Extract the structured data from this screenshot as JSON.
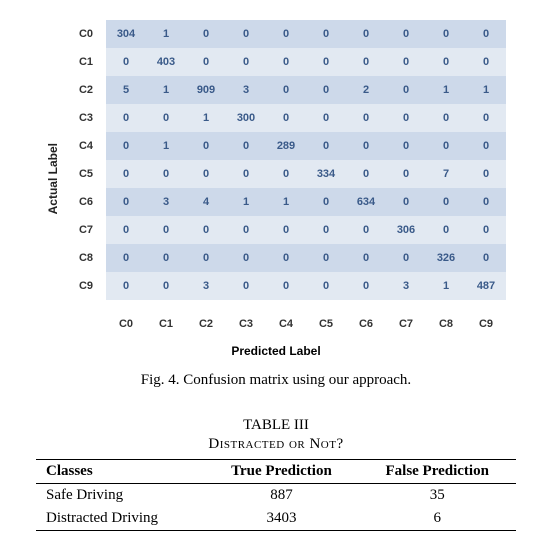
{
  "chart_data": {
    "type": "heatmap",
    "title": "",
    "xlabel": "Predicted Label",
    "ylabel": "Actual Label",
    "row_labels": [
      "C0",
      "C1",
      "C2",
      "C3",
      "C4",
      "C5",
      "C6",
      "C7",
      "C8",
      "C9"
    ],
    "col_labels": [
      "C0",
      "C1",
      "C2",
      "C3",
      "C4",
      "C5",
      "C6",
      "C7",
      "C8",
      "C9"
    ],
    "values": [
      [
        304,
        1,
        0,
        0,
        0,
        0,
        0,
        0,
        0,
        0
      ],
      [
        0,
        403,
        0,
        0,
        0,
        0,
        0,
        0,
        0,
        0
      ],
      [
        5,
        1,
        909,
        3,
        0,
        0,
        2,
        0,
        1,
        1
      ],
      [
        0,
        0,
        1,
        300,
        0,
        0,
        0,
        0,
        0,
        0
      ],
      [
        0,
        1,
        0,
        0,
        289,
        0,
        0,
        0,
        0,
        0
      ],
      [
        0,
        0,
        0,
        0,
        0,
        334,
        0,
        0,
        7,
        0
      ],
      [
        0,
        3,
        4,
        1,
        1,
        0,
        634,
        0,
        0,
        0
      ],
      [
        0,
        0,
        0,
        0,
        0,
        0,
        0,
        306,
        0,
        0
      ],
      [
        0,
        0,
        0,
        0,
        0,
        0,
        0,
        0,
        326,
        0
      ],
      [
        0,
        0,
        3,
        0,
        0,
        0,
        0,
        3,
        1,
        487
      ]
    ]
  },
  "fig_caption": "Fig. 4.    Confusion matrix using our approach.",
  "table3": {
    "label": "TABLE III",
    "caption": "Distracted or Not?",
    "headers": [
      "Classes",
      "True Prediction",
      "False Prediction"
    ],
    "rows": [
      {
        "class": "Safe Driving",
        "tp": "887",
        "fp": "35"
      },
      {
        "class": "Distracted Driving",
        "tp": "3403",
        "fp": "6"
      }
    ]
  }
}
